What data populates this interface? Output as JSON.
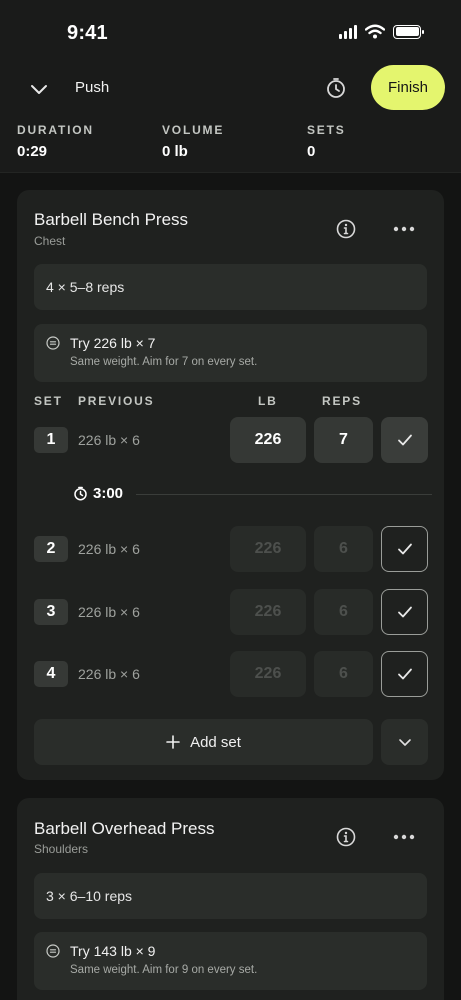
{
  "status_bar": {
    "time": "9:41"
  },
  "header": {
    "workout_name": "Push",
    "finish_label": "Finish"
  },
  "stats": [
    {
      "label": "DURATION",
      "value": "0:29"
    },
    {
      "label": "VOLUME",
      "value": "0 lb"
    },
    {
      "label": "SETS",
      "value": "0"
    }
  ],
  "exercises": [
    {
      "name": "Barbell Bench Press",
      "muscle": "Chest",
      "target": "4 × 5–8 reps",
      "tip_main": "Try 226 lb × 7",
      "tip_sub": "Same weight. Aim for 7 on every set.",
      "columns": {
        "set": "SET",
        "previous": "PREVIOUS",
        "lb": "LB",
        "reps": "REPS"
      },
      "sets": [
        {
          "number": "1",
          "previous": "226 lb × 6",
          "lb": "226",
          "reps": "7"
        },
        {
          "number": "2",
          "previous": "226 lb × 6",
          "lb": "226",
          "reps": "6"
        },
        {
          "number": "3",
          "previous": "226 lb × 6",
          "lb": "226",
          "reps": "6"
        },
        {
          "number": "4",
          "previous": "226 lb × 6",
          "lb": "226",
          "reps": "6"
        }
      ],
      "rest_timer": "3:00",
      "add_set_label": "Add set"
    },
    {
      "name": "Barbell Overhead Press",
      "muscle": "Shoulders",
      "target": "3 × 6–10 reps",
      "tip_main": "Try 143 lb × 9",
      "tip_sub": "Same weight. Aim for 9 on every set."
    }
  ],
  "colors": {
    "accent": "#e4f56e",
    "background": "#131413",
    "card": "#1f211f"
  }
}
